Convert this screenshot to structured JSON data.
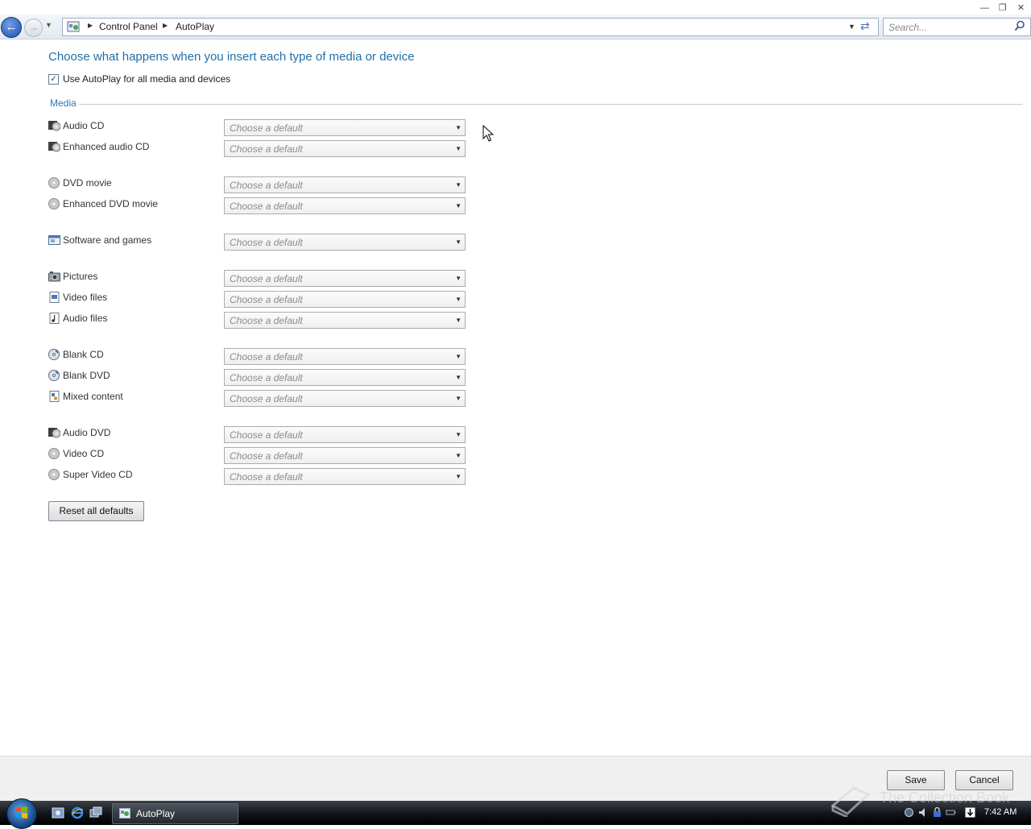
{
  "window": {
    "controls": {
      "minimize": "—",
      "maximize": "❐",
      "close": "✕"
    }
  },
  "address_bar": {
    "breadcrumbs": [
      "Control Panel",
      "AutoPlay"
    ],
    "search_placeholder": "Search..."
  },
  "content": {
    "heading": "Choose what happens when you insert each type of media or device",
    "use_autoplay_label": "Use AutoPlay for all media and devices",
    "use_autoplay_checked": true,
    "section_label": "Media",
    "select_placeholder": "Choose a default",
    "media": [
      {
        "label": "Audio CD",
        "icon": "audio-cd-icon"
      },
      {
        "label": "Enhanced audio CD",
        "icon": "audio-cd-icon"
      },
      {
        "label": "DVD movie",
        "icon": "disc-icon"
      },
      {
        "label": "Enhanced DVD movie",
        "icon": "disc-icon"
      },
      {
        "label": "Software and games",
        "icon": "software-icon"
      },
      {
        "label": "Pictures",
        "icon": "camera-icon"
      },
      {
        "label": "Video files",
        "icon": "video-file-icon"
      },
      {
        "label": "Audio files",
        "icon": "audio-file-icon"
      },
      {
        "label": "Blank CD",
        "icon": "blank-disc-icon"
      },
      {
        "label": "Blank DVD",
        "icon": "blank-disc-icon"
      },
      {
        "label": "Mixed content",
        "icon": "mixed-content-icon"
      },
      {
        "label": "Audio DVD",
        "icon": "audio-cd-icon"
      },
      {
        "label": "Video CD",
        "icon": "disc-icon"
      },
      {
        "label": "Super Video CD",
        "icon": "disc-icon"
      }
    ],
    "reset_button": "Reset all defaults"
  },
  "footer": {
    "save": "Save",
    "cancel": "Cancel"
  },
  "taskbar": {
    "active_task": "AutoPlay",
    "watermark": "The Collection Book",
    "clock": "7:42 AM"
  },
  "colors": {
    "heading": "#1f6fa8",
    "section": "#2a7ab8",
    "taskbar": "#101317"
  }
}
